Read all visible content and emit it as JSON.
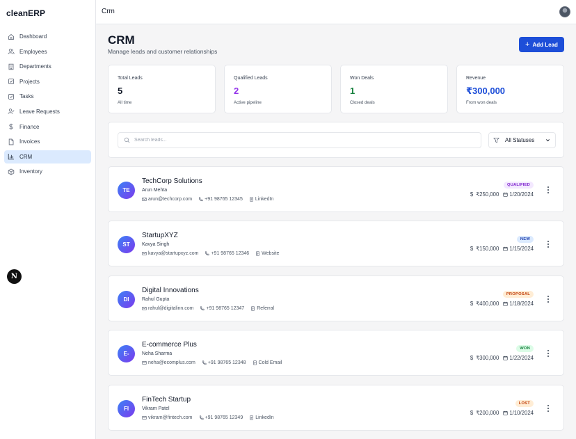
{
  "app": {
    "name": "cleanERP"
  },
  "sidebar": {
    "items": [
      {
        "label": "Dashboard",
        "icon": "home-icon",
        "active": false
      },
      {
        "label": "Employees",
        "icon": "users-icon",
        "active": false
      },
      {
        "label": "Departments",
        "icon": "building-icon",
        "active": false
      },
      {
        "label": "Projects",
        "icon": "checkbox-icon",
        "active": false
      },
      {
        "label": "Tasks",
        "icon": "checkbox-icon",
        "active": false
      },
      {
        "label": "Leave Requests",
        "icon": "user-check-icon",
        "active": false
      },
      {
        "label": "Finance",
        "icon": "dollar-icon",
        "active": false
      },
      {
        "label": "Invoices",
        "icon": "file-icon",
        "active": false
      },
      {
        "label": "CRM",
        "icon": "bar-chart-icon",
        "active": true
      },
      {
        "label": "Inventory",
        "icon": "box-icon",
        "active": false
      }
    ],
    "floating_badge": "N"
  },
  "topbar": {
    "title": "Crm"
  },
  "page": {
    "title": "CRM",
    "subtitle": "Manage leads and customer relationships",
    "add_button": "Add Lead"
  },
  "stats": [
    {
      "label": "Total Leads",
      "value": "5",
      "sub": "All time",
      "color": "#111827"
    },
    {
      "label": "Qualified Leads",
      "value": "2",
      "sub": "Active pipeline",
      "color": "#9333ea"
    },
    {
      "label": "Won Deals",
      "value": "1",
      "sub": "Closed deals",
      "color": "#15803d"
    },
    {
      "label": "Revenue",
      "value": "₹300,000",
      "sub": "From won deals",
      "color": "#1d4ed8"
    }
  ],
  "filters": {
    "search_placeholder": "Search leads...",
    "status_value": "All Statuses"
  },
  "leads": [
    {
      "initials": "TE",
      "company": "TechCorp Solutions",
      "contact": "Arun Mehta",
      "email": "arun@techcorp.com",
      "phone": "+91 98765 12345",
      "source": "LinkedIn",
      "status": "QUALIFIED",
      "status_bg": "#f3e8ff",
      "status_fg": "#7e22ce",
      "value": "₹250,000",
      "date": "1/20/2024"
    },
    {
      "initials": "ST",
      "company": "StartupXYZ",
      "contact": "Kavya Singh",
      "email": "kavya@startupxyz.com",
      "phone": "+91 98765 12346",
      "source": "Website",
      "status": "NEW",
      "status_bg": "#dbeafe",
      "status_fg": "#1e40af",
      "value": "₹150,000",
      "date": "1/15/2024"
    },
    {
      "initials": "DI",
      "company": "Digital Innovations",
      "contact": "Rahul Gupta",
      "email": "rahul@digitalinn.com",
      "phone": "+91 98765 12347",
      "source": "Referral",
      "status": "PROPOSAL",
      "status_bg": "#ffedd5",
      "status_fg": "#c2410c",
      "value": "₹400,000",
      "date": "1/18/2024"
    },
    {
      "initials": "E-",
      "company": "E-commerce Plus",
      "contact": "Neha Sharma",
      "email": "neha@ecomplus.com",
      "phone": "+91 98765 12348",
      "source": "Cold Email",
      "status": "WON",
      "status_bg": "#dcfce7",
      "status_fg": "#15803d",
      "value": "₹300,000",
      "date": "1/22/2024"
    },
    {
      "initials": "FI",
      "company": "FinTech Startup",
      "contact": "Vikram Patel",
      "email": "vikram@fintech.com",
      "phone": "+91 98765 12349",
      "source": "LinkedIn",
      "status": "LOST",
      "status_bg": "#ffedd5",
      "status_fg": "#c2410c",
      "value": "₹200,000",
      "date": "1/10/2024"
    }
  ]
}
